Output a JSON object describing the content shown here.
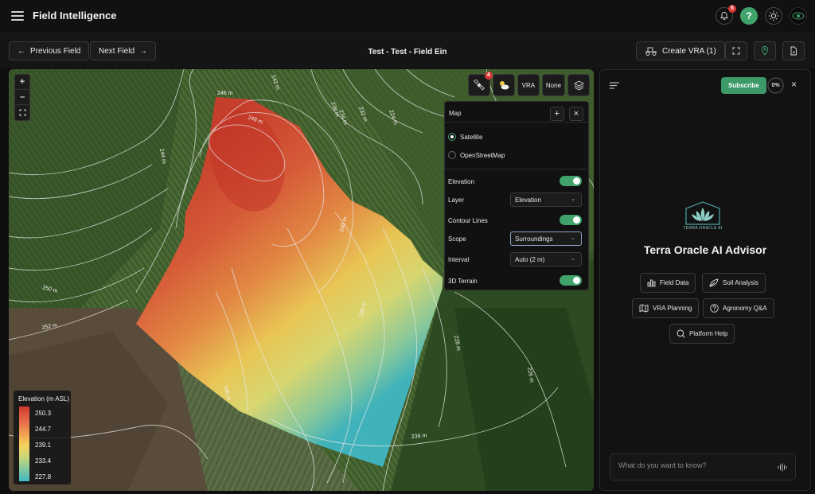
{
  "header": {
    "title": "Field Intelligence",
    "notifications": "5"
  },
  "nav": {
    "prev_label": "Previous Field",
    "next_label": "Next Field",
    "field_title": "Test - Test - Field Ein",
    "create_vra_label": "Create VRA (1)"
  },
  "map": {
    "tools": {
      "satellite_badge": "4",
      "vra_label": "VRA",
      "none_label": "None"
    },
    "contours": [
      {
        "label": "246 m"
      },
      {
        "label": "248 m"
      },
      {
        "label": "242 m"
      },
      {
        "label": "238 m"
      },
      {
        "label": "234 m"
      },
      {
        "label": "232 m"
      },
      {
        "label": "224 m"
      },
      {
        "label": "244 m"
      },
      {
        "label": "250 m"
      },
      {
        "label": "252 m"
      },
      {
        "label": "246 m"
      },
      {
        "label": "240 m"
      },
      {
        "label": "236 m"
      },
      {
        "label": "228 m"
      },
      {
        "label": "226 m"
      },
      {
        "label": "230 m"
      }
    ],
    "legend": {
      "title": "Elevation (m ASL)",
      "values": [
        "250.3",
        "244.7",
        "239.1",
        "233.4",
        "227.8"
      ]
    }
  },
  "layer_panel": {
    "title": "Map",
    "base_options": [
      {
        "label": "Satellite",
        "selected": true
      },
      {
        "label": "OpenStreetMap",
        "selected": false
      }
    ],
    "elevation_label": "Elevation",
    "layer_label": "Layer",
    "layer_value": "Elevation",
    "contour_label": "Contour Lines",
    "scope_label": "Scope",
    "scope_value": "Surroundings",
    "interval_label": "Interval",
    "interval_value": "Auto (2 m)",
    "terrain_label": "3D Terrain"
  },
  "advisor": {
    "subscribe_label": "Subscribe",
    "progress": "0%",
    "logo_text": "TERRA ORACLE AI",
    "title": "Terra Oracle AI Advisor",
    "chips": [
      "Field Data",
      "Soil Analysis",
      "VRA Planning",
      "Agronomy Q&A",
      "Platform Help"
    ],
    "input_placeholder": "What do you want to know?"
  },
  "colors": {
    "accent": "#3fa36b",
    "high": "#cf3b2b",
    "mid": "#f5d35c",
    "low": "#3fb8c5"
  }
}
